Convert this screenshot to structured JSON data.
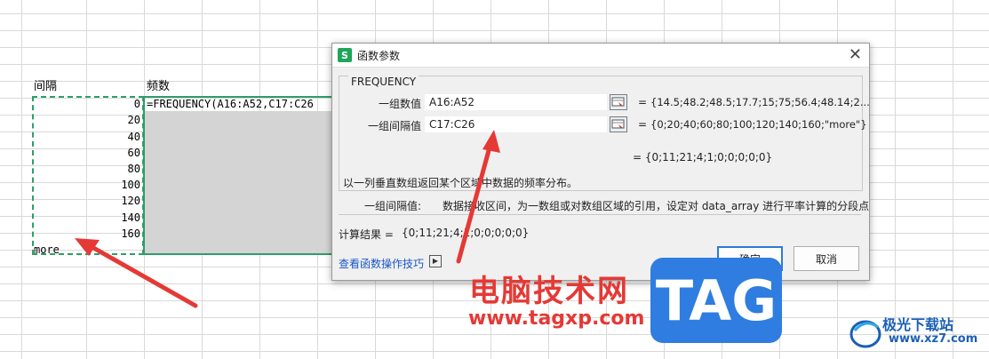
{
  "sheet": {
    "header_interval": "间隔",
    "header_frequency": "频数",
    "interval_values": [
      "0",
      "20",
      "40",
      "60",
      "80",
      "100",
      "120",
      "140",
      "160"
    ],
    "last_label": "more",
    "formula_text": "=FREQUENCY(A16:A52,C17:C26"
  },
  "dialog": {
    "title": "函数参数",
    "app_icon": "S",
    "function_name": "FREQUENCY",
    "args": [
      {
        "label": "一组数值",
        "input": "A16:A52",
        "value": "{14.5;48.2;48.5;17.7;15;75;56.4;48.14;2..."
      },
      {
        "label": "一组间隔值",
        "input": "C17:C26",
        "value": "{0;20;40;60;80;100;120;140;160;\"more\"}"
      }
    ],
    "equals": "=",
    "formula_result_inline": "= {0;11;21;4;1;0;0;0;0;0}",
    "description": "以一列垂直数组返回某个区域中数据的频率分布。",
    "param_help_name": "一组间隔值:",
    "param_help_text": "数据接收区间，为一数组或对数组区域的引用，设定对 data_array 进行平率计算的分段点",
    "result_label": "计算结果 =",
    "result_value": "{0;11;21;4;1;0;0;0;0;0}",
    "help_link": "查看函数操作技巧",
    "ok_label": "确定",
    "cancel_label": "取消"
  },
  "watermark": {
    "site_cn": "电脑技术网",
    "site_url": "www.tagxp.com",
    "tag_logo": "TAG",
    "xz_cn": "极光下载站",
    "xz_url": "www.xz7.com"
  },
  "colors": {
    "selection_green": "#2e9e6a",
    "annotation_red": "#e53935",
    "tag_blue": "#2f7de0",
    "link_blue": "#1a56c6"
  }
}
